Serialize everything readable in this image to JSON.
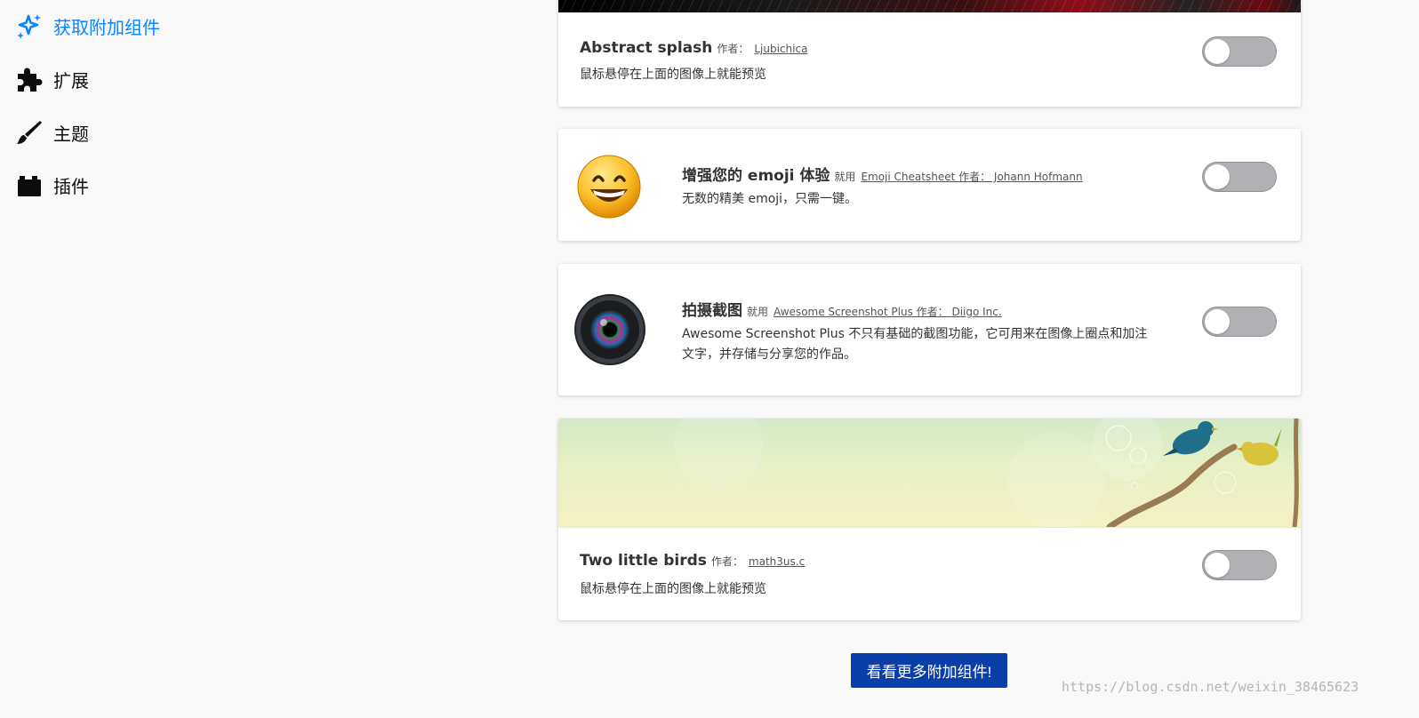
{
  "sidebar": {
    "items": [
      {
        "label": "获取附加组件",
        "icon": "sparkle-icon",
        "active": true
      },
      {
        "label": "扩展",
        "icon": "puzzle-icon"
      },
      {
        "label": "主题",
        "icon": "brush-icon"
      },
      {
        "label": "插件",
        "icon": "plugin-block-icon"
      }
    ]
  },
  "addons": [
    {
      "name": "Abstract splash",
      "author_prefix": "作者：",
      "author": "Ljubichica",
      "description": "鼠标悬停在上面的图像上就能预览",
      "enabled": false
    },
    {
      "name": "增强您的 emoji 体验",
      "meta": "就用",
      "link": "Emoji Cheatsheet 作者： Johann Hofmann",
      "description": "无数的精美 emoji，只需一键。",
      "icon": "smiley-emoji-icon",
      "enabled": false
    },
    {
      "name": "拍摄截图",
      "meta": "就用",
      "link": "Awesome Screenshot Plus 作者： Diigo Inc.",
      "description_line1": "Awesome Screenshot Plus 不只有基础的截图功能，它可用来在图像上圈点和加注",
      "description_line2": "文字，并存储与分享您的作品。",
      "icon": "camera-lens-icon",
      "enabled": false
    },
    {
      "name": "Two little birds",
      "author_prefix": "作者：",
      "author": "math3us.c",
      "description": "鼠标悬停在上面的图像上就能预览",
      "enabled": false
    }
  ],
  "more_button": "看看更多附加组件!",
  "watermark": "https://blog.csdn.net/weixin_38465623",
  "colors": {
    "accent": "#0a84ff",
    "button": "#0a3ea8",
    "toggle_off": "#b1b1b3"
  }
}
